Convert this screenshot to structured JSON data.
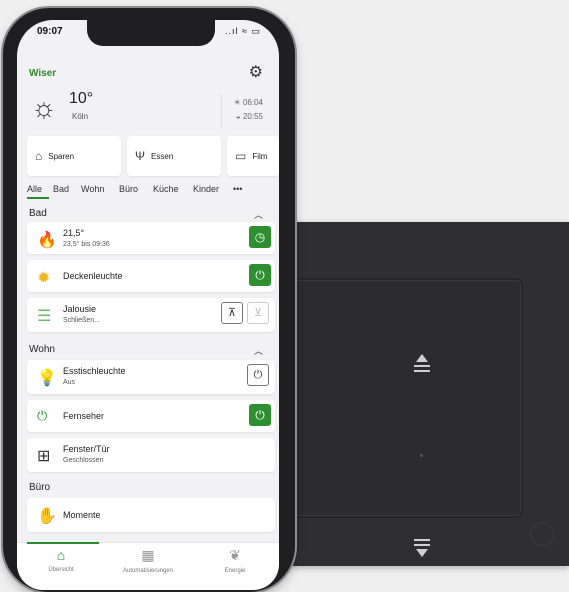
{
  "status": {
    "time": "09:07",
    "indicators": "..ıl ≈ ▭"
  },
  "brand": {
    "logo": "Wiser"
  },
  "weather": {
    "icon": "sun-icon",
    "temperature": "10°",
    "city": "Köln",
    "sunrise": "06:04",
    "sunset": "20:55"
  },
  "scenes": [
    {
      "label": "Sparen",
      "icon": "piggy-bank-icon"
    },
    {
      "label": "Essen",
      "icon": "dining-icon"
    },
    {
      "label": "Film",
      "icon": "tv-icon"
    }
  ],
  "tabs": [
    "Alle",
    "Bad",
    "Wohn",
    "Büro",
    "Küche",
    "Kinder",
    "•••"
  ],
  "sections": {
    "bad": "Bad",
    "wohn": "Wohn",
    "buero": "Büro"
  },
  "devices": {
    "heating": {
      "title": "21,5°",
      "sub": "23,5° bis 09:36"
    },
    "ceiling_light": {
      "title": "Deckenleuchte"
    },
    "blind": {
      "title": "Jalousie",
      "sub": "Schließen..."
    },
    "dining_light": {
      "title": "Esstischleuchte",
      "sub": "Aus"
    },
    "tv": {
      "title": "Fernseher"
    },
    "window": {
      "title": "Fenster/Tür",
      "sub": "Geschlossen"
    },
    "moments": {
      "title": "Momente"
    }
  },
  "nav": [
    {
      "label": "Übersicht",
      "icon": "home-icon"
    },
    {
      "label": "Automatisierungen",
      "icon": "grid-icon"
    },
    {
      "label": "Energie",
      "icon": "leaf-icon"
    }
  ],
  "colors": {
    "accent": "#2e8f2e",
    "panel": "#2f2f31"
  }
}
